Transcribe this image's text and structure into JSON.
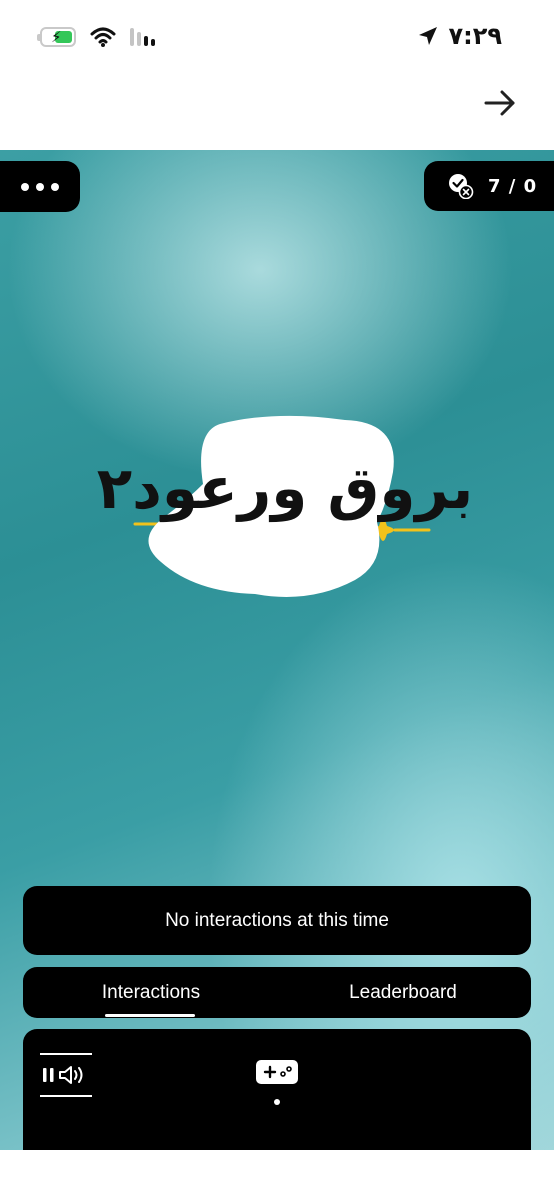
{
  "status_bar": {
    "time": "٧:٢٩",
    "icons": [
      "battery-charging-icon",
      "wifi-icon",
      "cellular-signal-icon",
      "location-arrow-icon"
    ]
  },
  "header": {
    "back_icon": "arrow-right-icon"
  },
  "stage": {
    "more_icon": "more-dots-icon",
    "score_icon": "check-x-icon",
    "score": "7 / 0",
    "logo_text": "بروق ورعود٢"
  },
  "panel": {
    "message": "No interactions at this time"
  },
  "tabs": [
    {
      "label": "Interactions",
      "active": true
    },
    {
      "label": "Leaderboard",
      "active": false
    }
  ],
  "controls": {
    "media_icon": "pause-volume-icon",
    "game_icon": "gamepad-icon"
  },
  "colors": {
    "accent": "#f2c21b",
    "panel": "#000000",
    "teal": "#2c8f95"
  }
}
